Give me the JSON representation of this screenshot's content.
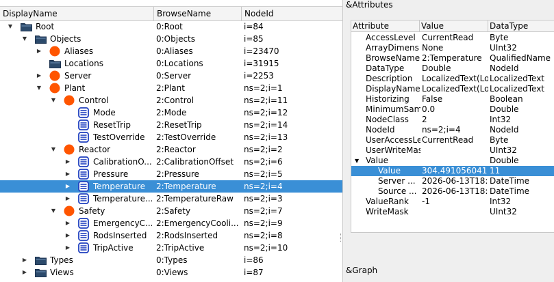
{
  "tree": {
    "columns": [
      "DisplayName",
      "BrowseName",
      "NodeId"
    ],
    "rows": [
      {
        "level": 0,
        "arrow": "down",
        "icon": "folder",
        "name": "Root",
        "browse": "0:Root",
        "nodeid": "i=84"
      },
      {
        "level": 1,
        "arrow": "down",
        "icon": "folder",
        "name": "Objects",
        "browse": "0:Objects",
        "nodeid": "i=85"
      },
      {
        "level": 2,
        "arrow": "right",
        "icon": "object",
        "name": "Aliases",
        "browse": "0:Aliases",
        "nodeid": "i=23470"
      },
      {
        "level": 2,
        "arrow": "none",
        "icon": "folder",
        "name": "Locations",
        "browse": "0:Locations",
        "nodeid": "i=31915"
      },
      {
        "level": 2,
        "arrow": "right",
        "icon": "object",
        "name": "Server",
        "browse": "0:Server",
        "nodeid": "i=2253"
      },
      {
        "level": 2,
        "arrow": "down",
        "icon": "object",
        "name": "Plant",
        "browse": "2:Plant",
        "nodeid": "ns=2;i=1"
      },
      {
        "level": 3,
        "arrow": "down",
        "icon": "object",
        "name": "Control",
        "browse": "2:Control",
        "nodeid": "ns=2;i=11"
      },
      {
        "level": 4,
        "arrow": "none",
        "icon": "variable",
        "name": "Mode",
        "browse": "2:Mode",
        "nodeid": "ns=2;i=12"
      },
      {
        "level": 4,
        "arrow": "none",
        "icon": "variable",
        "name": "ResetTrip",
        "browse": "2:ResetTrip",
        "nodeid": "ns=2;i=14"
      },
      {
        "level": 4,
        "arrow": "none",
        "icon": "variable",
        "name": "TestOverride",
        "browse": "2:TestOverride",
        "nodeid": "ns=2;i=13"
      },
      {
        "level": 3,
        "arrow": "down",
        "icon": "object",
        "name": "Reactor",
        "browse": "2:Reactor",
        "nodeid": "ns=2;i=2"
      },
      {
        "level": 4,
        "arrow": "right",
        "icon": "variable",
        "name": "CalibrationO...",
        "browse": "2:CalibrationOffset",
        "nodeid": "ns=2;i=6"
      },
      {
        "level": 4,
        "arrow": "right",
        "icon": "variable",
        "name": "Pressure",
        "browse": "2:Pressure",
        "nodeid": "ns=2;i=5"
      },
      {
        "level": 4,
        "arrow": "right",
        "icon": "variable",
        "name": "Temperature",
        "browse": "2:Temperature",
        "nodeid": "ns=2;i=4",
        "selected": true
      },
      {
        "level": 4,
        "arrow": "right",
        "icon": "variable",
        "name": "Temperature...",
        "browse": "2:TemperatureRaw",
        "nodeid": "ns=2;i=3"
      },
      {
        "level": 3,
        "arrow": "down",
        "icon": "object",
        "name": "Safety",
        "browse": "2:Safety",
        "nodeid": "ns=2;i=7"
      },
      {
        "level": 4,
        "arrow": "right",
        "icon": "variable",
        "name": "EmergencyC...",
        "browse": "2:EmergencyCooli...",
        "nodeid": "ns=2;i=9"
      },
      {
        "level": 4,
        "arrow": "right",
        "icon": "variable",
        "name": "RodsInserted",
        "browse": "2:RodsInserted",
        "nodeid": "ns=2;i=8"
      },
      {
        "level": 4,
        "arrow": "right",
        "icon": "variable",
        "name": "TripActive",
        "browse": "2:TripActive",
        "nodeid": "ns=2;i=10"
      },
      {
        "level": 1,
        "arrow": "right",
        "icon": "folder",
        "name": "Types",
        "browse": "0:Types",
        "nodeid": "i=86"
      },
      {
        "level": 1,
        "arrow": "right",
        "icon": "folder",
        "name": "Views",
        "browse": "0:Views",
        "nodeid": "i=87"
      }
    ]
  },
  "attributes": {
    "title": "&Attributes",
    "columns": [
      "Attribute",
      "Value",
      "DataType"
    ],
    "rows": [
      {
        "level": 0,
        "arrow": "none",
        "attr": "AccessLevel",
        "value": "CurrentRead",
        "type": "Byte"
      },
      {
        "level": 0,
        "arrow": "none",
        "attr": "ArrayDimens",
        "value": "None",
        "type": "UInt32"
      },
      {
        "level": 0,
        "arrow": "none",
        "attr": "BrowseName",
        "value": "2:Temperature",
        "type": "QualifiedName"
      },
      {
        "level": 0,
        "arrow": "none",
        "attr": "DataType",
        "value": "Double",
        "type": "NodeId"
      },
      {
        "level": 0,
        "arrow": "none",
        "attr": "Description",
        "value": "LocalizedText(Lo",
        "type": "LocalizedText"
      },
      {
        "level": 0,
        "arrow": "none",
        "attr": "DisplayName",
        "value": "LocalizedText(Lo",
        "type": "LocalizedText"
      },
      {
        "level": 0,
        "arrow": "none",
        "attr": "Historizing",
        "value": "False",
        "type": "Boolean"
      },
      {
        "level": 0,
        "arrow": "none",
        "attr": "MinimumSam",
        "value": "0.0",
        "type": "Double"
      },
      {
        "level": 0,
        "arrow": "none",
        "attr": "NodeClass",
        "value": "2",
        "type": "Int32"
      },
      {
        "level": 0,
        "arrow": "none",
        "attr": "NodeId",
        "value": "ns=2;i=4",
        "type": "NodeId"
      },
      {
        "level": 0,
        "arrow": "none",
        "attr": "UserAccessLe",
        "value": "CurrentRead",
        "type": "Byte"
      },
      {
        "level": 0,
        "arrow": "none",
        "attr": "UserWriteMas",
        "value": "",
        "type": "UInt32"
      },
      {
        "level": 0,
        "arrow": "down",
        "attr": "Value",
        "value": "",
        "type": "Double"
      },
      {
        "level": 1,
        "arrow": "none",
        "attr": "Value",
        "value": "304.491056041",
        "type": "11",
        "selected": true
      },
      {
        "level": 1,
        "arrow": "none",
        "attr": "Server ...",
        "value": "2026-06-13T18:",
        "type": "DateTime"
      },
      {
        "level": 1,
        "arrow": "none",
        "attr": "Source ...",
        "value": "2026-06-13T18:",
        "type": "DateTime"
      },
      {
        "level": 0,
        "arrow": "none",
        "attr": "ValueRank",
        "value": "-1",
        "type": "Int32"
      },
      {
        "level": 0,
        "arrow": "none",
        "attr": "WriteMask",
        "value": "",
        "type": "UInt32"
      }
    ]
  },
  "graph": {
    "title": "&Graph"
  },
  "colors": {
    "selection": "#3a8fd6",
    "object": "#ff5500",
    "variable": "#1f3fbf",
    "folder": "#2c4a6b"
  }
}
